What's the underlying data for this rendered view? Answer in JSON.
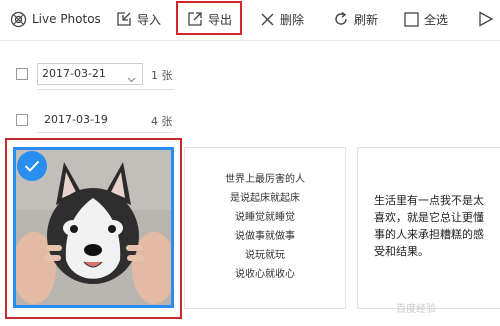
{
  "toolbar": {
    "live_photos": "Live Photos",
    "import": "导入",
    "export": "导出",
    "delete": "删除",
    "refresh": "刷新",
    "select_all": "全选"
  },
  "groups": [
    {
      "date": "2017-03-21",
      "count": "1 张"
    },
    {
      "date": "2017-03-19",
      "count": "4 张"
    }
  ],
  "cards": {
    "card2_lines": [
      "世界上最厉害的人",
      "是说起床就起床",
      "说睡觉就睡觉",
      "说做事就做事",
      "说玩就玩",
      "说收心就收心"
    ],
    "card3_lines": [
      "生活里有一点我不是太",
      "喜欢，就是它总让更懂",
      "事的人来承担糟糕的感",
      "受和结果。"
    ]
  },
  "watermark": "百度经验",
  "colors": {
    "accent": "#2a8df0",
    "highlight": "#d0272d"
  }
}
